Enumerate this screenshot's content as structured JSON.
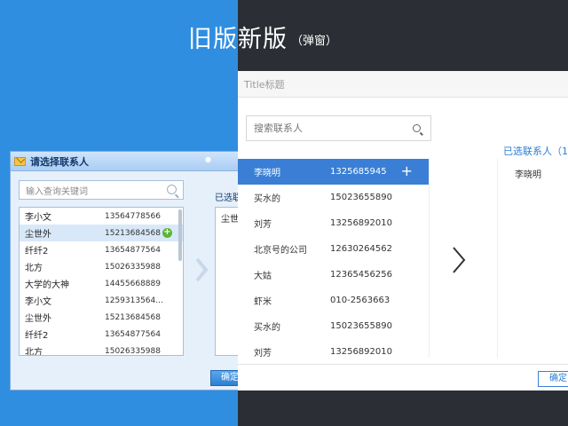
{
  "headline": {
    "title": "旧版新版",
    "subtitle": "（弹窗）"
  },
  "old_dialog": {
    "title": "请选择联系人",
    "search_placeholder": "输入查询关键词",
    "selected_label": "已选联",
    "confirm_label": "确定",
    "contacts": [
      {
        "name": "李小文",
        "phone": "13564778566"
      },
      {
        "name": "尘世外",
        "phone": "15213684568",
        "selected": true
      },
      {
        "name": "纤纤2",
        "phone": "13654877564"
      },
      {
        "name": "北方",
        "phone": "15026335988"
      },
      {
        "name": "大学的大神",
        "phone": "14455668889"
      },
      {
        "name": "李小文",
        "phone": "1259313564..."
      },
      {
        "name": "尘世外",
        "phone": "15213684568"
      },
      {
        "name": "纤纤2",
        "phone": "13654877564"
      },
      {
        "name": "北方",
        "phone": "15026335988"
      }
    ],
    "selected_items": [
      "尘世"
    ]
  },
  "new_dialog": {
    "title": "Title标题",
    "search_placeholder": "搜索联系人",
    "selected_label": "已选联系人（1",
    "confirm_label": "确定",
    "contacts": [
      {
        "name": "李晓明",
        "phone": "1325685945",
        "selected": true
      },
      {
        "name": "买水的",
        "phone": "15023655890"
      },
      {
        "name": "刘芳",
        "phone": "13256892010"
      },
      {
        "name": "北京号的公司",
        "phone": "12630264562"
      },
      {
        "name": "大姑",
        "phone": "12365456256"
      },
      {
        "name": "虾米",
        "phone": "010-2563663"
      },
      {
        "name": "买水的",
        "phone": "15023655890"
      },
      {
        "name": "刘芳",
        "phone": "13256892010"
      }
    ],
    "selected_items": [
      "李晓明"
    ]
  },
  "colors": {
    "old_bg": "#2f8ee0",
    "new_bg": "#2b2f35",
    "accent": "#3a7fd5",
    "add_green": "#5cb531"
  }
}
